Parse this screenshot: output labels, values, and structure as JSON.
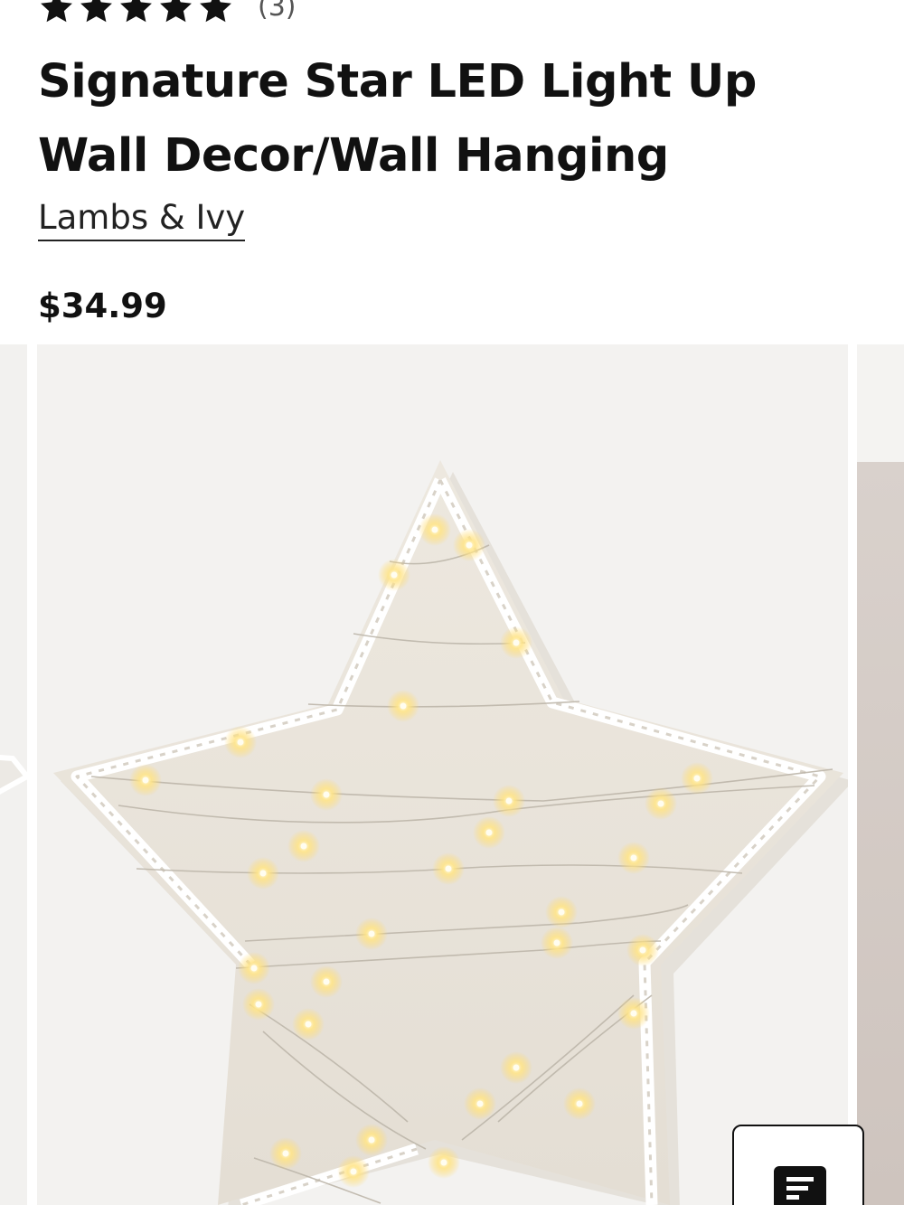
{
  "product": {
    "rating": 5,
    "review_count": "(3)",
    "title": "Signature Star LED Light Up Wall Decor/Wall Hanging",
    "brand": "Lambs & Ivy",
    "price": "$34.99"
  },
  "icons": {
    "rating_star": "star-icon",
    "chat": "chat-bubble-icon"
  },
  "colors": {
    "text": "#111111",
    "star": "#111111",
    "image_bg": "#f3f2f0",
    "led_glow": "#ffd96b"
  }
}
